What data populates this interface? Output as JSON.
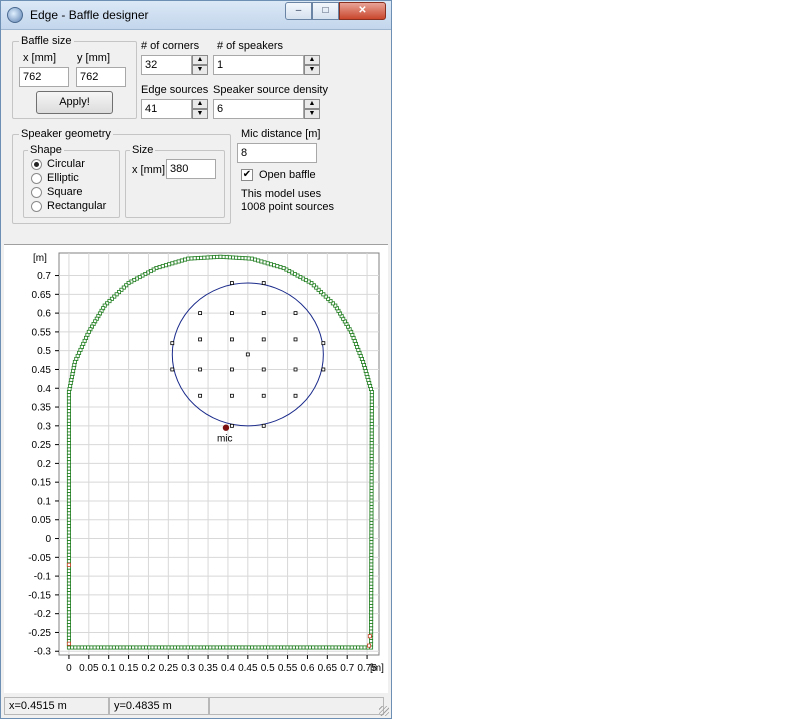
{
  "window": {
    "title": "Edge - Baffle designer",
    "controls": {
      "minimize": "–",
      "maximize": "□",
      "close": "✕"
    }
  },
  "baffle_size": {
    "group_label": "Baffle size",
    "x_label": "x [mm]",
    "y_label": "y [mm]",
    "x_value": "762",
    "y_value": "762",
    "apply_label": "Apply!"
  },
  "params": {
    "corners_label": "# of corners",
    "corners_value": "32",
    "speakers_label": "# of speakers",
    "speakers_value": "1",
    "edge_sources_label": "Edge sources",
    "edge_sources_value": "41",
    "density_label": "Speaker source density",
    "density_value": "6"
  },
  "speaker_geometry": {
    "group_label": "Speaker geometry",
    "shape_label": "Shape",
    "shapes": [
      "Circular",
      "Elliptic",
      "Square",
      "Rectangular"
    ],
    "selected_shape": 0,
    "size_label": "Size",
    "size_x_label": "x [mm]",
    "size_x_value": "380"
  },
  "mic": {
    "distance_label": "Mic distance [m]",
    "distance_value": "8",
    "open_baffle_label": "Open baffle",
    "open_baffle_checked": true,
    "model_line1": "This model uses",
    "model_line2": "1008 point sources"
  },
  "chart_data": {
    "type": "scatter",
    "xlabel": "[m]",
    "ylabel": "[m]",
    "xlim": [
      -0.025,
      0.78
    ],
    "ylim": [
      -0.31,
      0.76
    ],
    "x_ticks": [
      0,
      0.05,
      0.1,
      0.15,
      0.2,
      0.25,
      0.3,
      0.35,
      0.4,
      0.45,
      0.5,
      0.55,
      0.6,
      0.65,
      0.7,
      0.75
    ],
    "x_tick_labels": [
      "0",
      "0.05",
      "0.1",
      "0.15",
      "0.2",
      "0.25",
      "0.3",
      "0.35",
      "0.4",
      "0.45",
      "0.5",
      "0.55",
      "0.6",
      "0.65",
      "0.7",
      "0.75"
    ],
    "y_ticks": [
      0.7,
      0.65,
      0.6,
      0.55,
      0.5,
      0.45,
      0.4,
      0.35,
      0.3,
      0.25,
      0.2,
      0.15,
      0.1,
      0.05,
      0,
      -0.05,
      -0.1,
      -0.15,
      -0.2,
      -0.25,
      -0.3
    ],
    "y_tick_labels": [
      "0.7",
      "0.65",
      "0.6",
      "0.55",
      "0.5",
      "0.45",
      "0.4",
      "0.35",
      "0.3",
      "0.25",
      "0.2",
      "0.15",
      "0.1",
      "0.05",
      "0",
      "-0.05",
      "-0.1",
      "-0.15",
      "-0.2",
      "-0.25",
      "-0.3"
    ],
    "grid": true,
    "baffle_outline": {
      "color": "#1a7a1a",
      "vertices": [
        [
          0,
          -0.29
        ],
        [
          0.76,
          -0.29
        ],
        [
          0.762,
          0.39
        ],
        [
          0.74,
          0.47
        ],
        [
          0.71,
          0.55
        ],
        [
          0.67,
          0.62
        ],
        [
          0.61,
          0.68
        ],
        [
          0.54,
          0.72
        ],
        [
          0.46,
          0.745
        ],
        [
          0.381,
          0.75
        ],
        [
          0.3,
          0.745
        ],
        [
          0.22,
          0.72
        ],
        [
          0.15,
          0.68
        ],
        [
          0.09,
          0.62
        ],
        [
          0.05,
          0.55
        ],
        [
          0.015,
          0.47
        ],
        [
          0,
          0.39
        ]
      ]
    },
    "speaker": {
      "cx": 0.45,
      "cy": 0.49,
      "r": 0.19,
      "color": "#1a2a8a"
    },
    "speaker_sources": [
      [
        0.41,
        0.68
      ],
      [
        0.49,
        0.68
      ],
      [
        0.33,
        0.6
      ],
      [
        0.41,
        0.6
      ],
      [
        0.49,
        0.6
      ],
      [
        0.57,
        0.6
      ],
      [
        0.26,
        0.52
      ],
      [
        0.33,
        0.53
      ],
      [
        0.41,
        0.53
      ],
      [
        0.49,
        0.53
      ],
      [
        0.57,
        0.53
      ],
      [
        0.64,
        0.52
      ],
      [
        0.45,
        0.49
      ],
      [
        0.26,
        0.45
      ],
      [
        0.33,
        0.45
      ],
      [
        0.41,
        0.45
      ],
      [
        0.49,
        0.45
      ],
      [
        0.57,
        0.45
      ],
      [
        0.64,
        0.45
      ],
      [
        0.33,
        0.38
      ],
      [
        0.41,
        0.38
      ],
      [
        0.49,
        0.38
      ],
      [
        0.57,
        0.38
      ],
      [
        0.41,
        0.3
      ],
      [
        0.49,
        0.3
      ]
    ],
    "mic_point": {
      "x": 0.395,
      "y": 0.295,
      "label": "mic",
      "color": "#7a1010"
    },
    "edge_marker_points": [
      [
        0,
        -0.28
      ],
      [
        0.755,
        -0.285
      ],
      [
        0,
        -0.07
      ],
      [
        0.757,
        -0.26
      ]
    ]
  },
  "status": {
    "x_readout": "x=0.4515 m",
    "y_readout": "y=0.4835 m"
  }
}
